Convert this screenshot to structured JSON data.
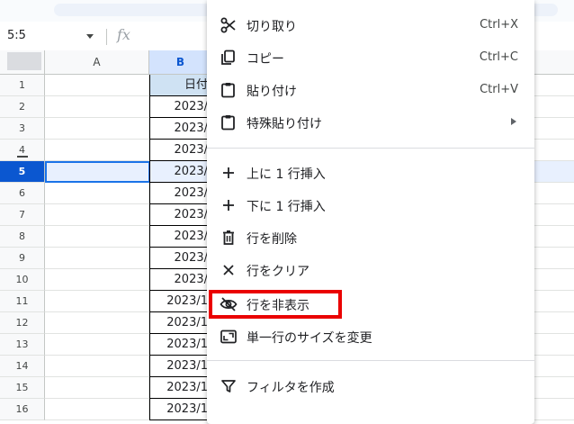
{
  "formula_bar": {
    "name_box": "5:5",
    "fx": "fx"
  },
  "columns": [
    {
      "label": "A"
    },
    {
      "label": "B"
    }
  ],
  "rows": [
    {
      "num": "1",
      "b": "日付"
    },
    {
      "num": "2",
      "b": "2023/"
    },
    {
      "num": "3",
      "b": "2023/"
    },
    {
      "num": "4",
      "b": "2023/"
    },
    {
      "num": "5",
      "b": "2023/"
    },
    {
      "num": "6",
      "b": "2023/"
    },
    {
      "num": "7",
      "b": "2023/"
    },
    {
      "num": "8",
      "b": "2023/"
    },
    {
      "num": "9",
      "b": "2023/"
    },
    {
      "num": "10",
      "b": "2023/"
    },
    {
      "num": "11",
      "b": "2023/1"
    },
    {
      "num": "12",
      "b": "2023/1"
    },
    {
      "num": "13",
      "b": "2023/1"
    },
    {
      "num": "14",
      "b": "2023/1"
    },
    {
      "num": "15",
      "b": "2023/1"
    },
    {
      "num": "16",
      "b": "2023/1"
    }
  ],
  "menu": {
    "items": [
      {
        "icon": "scissors-icon",
        "label": "切り取り",
        "shortcut": "Ctrl+X"
      },
      {
        "icon": "copy-icon",
        "label": "コピー",
        "shortcut": "Ctrl+C"
      },
      {
        "icon": "paste-icon",
        "label": "貼り付け",
        "shortcut": "Ctrl+V"
      },
      {
        "icon": "paste-special-icon",
        "label": "特殊貼り付け",
        "shortcut": ""
      },
      {
        "icon": "plus-icon",
        "label": "上に 1 行挿入",
        "shortcut": ""
      },
      {
        "icon": "plus-icon",
        "label": "下に 1 行挿入",
        "shortcut": ""
      },
      {
        "icon": "trash-icon",
        "label": "行を削除",
        "shortcut": ""
      },
      {
        "icon": "close-icon",
        "label": "行をクリア",
        "shortcut": ""
      },
      {
        "icon": "eye-off-icon",
        "label": "行を非表示",
        "shortcut": ""
      },
      {
        "icon": "resize-icon",
        "label": "単一行のサイズを変更",
        "shortcut": ""
      },
      {
        "icon": "filter-icon",
        "label": "フィルタを作成",
        "shortcut": ""
      }
    ]
  },
  "colors": {
    "highlight": "#ea0000",
    "selection": "#0b57d0"
  }
}
